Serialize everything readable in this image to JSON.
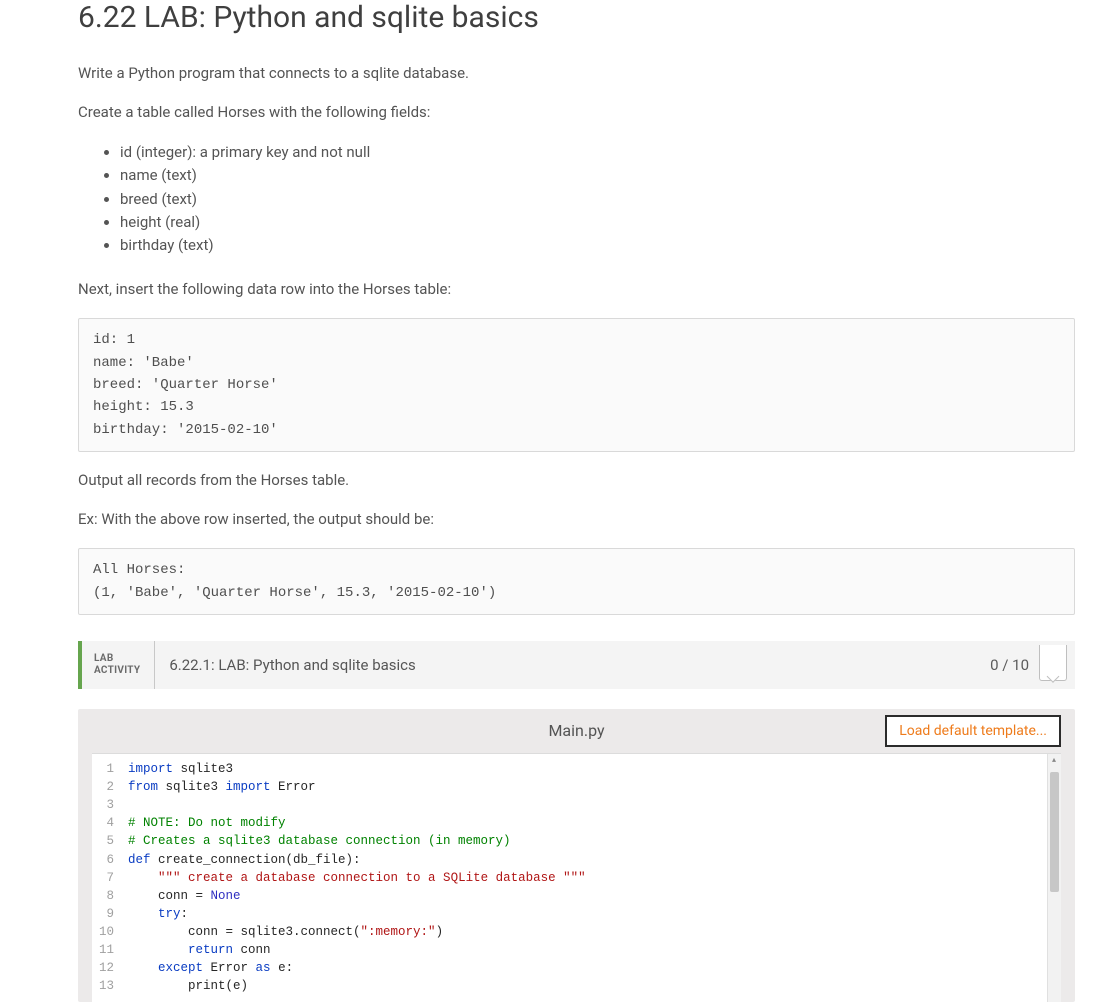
{
  "title": "6.22 LAB: Python and sqlite basics",
  "intro": {
    "p1": "Write a Python program that connects to a sqlite database.",
    "p2": "Create a table called Horses with the following fields:",
    "bullets": [
      "id (integer): a primary key and not null",
      "name (text)",
      "breed (text)",
      "height (real)",
      "birthday (text)"
    ],
    "p3": "Next, insert the following data row into the Horses table:"
  },
  "insert_block": "id: 1\nname: 'Babe'\nbreed: 'Quarter Horse'\nheight: 15.3\nbirthday: '2015-02-10'",
  "output_prompt": "Output all records from the Horses table.",
  "output_ex_label": "Ex: With the above row inserted, the output should be:",
  "output_block": "All Horses:\n(1, 'Babe', 'Quarter Horse', 15.3, '2015-02-10')",
  "lab": {
    "label_line1": "LAB",
    "label_line2": "ACTIVITY",
    "title": "6.22.1: LAB: Python and sqlite basics",
    "score": "0 / 10"
  },
  "editor": {
    "filename": "Main.py",
    "load_button": "Load default template...",
    "line_numbers": [
      "1",
      "2",
      "3",
      "4",
      "5",
      "6",
      "7",
      "8",
      "9",
      "10",
      "11",
      "12",
      "13"
    ],
    "tokens": [
      [
        [
          "kw",
          "import"
        ],
        [
          "id",
          " sqlite3"
        ]
      ],
      [
        [
          "kw",
          "from"
        ],
        [
          "id",
          " sqlite3 "
        ],
        [
          "kw",
          "import"
        ],
        [
          "id",
          " Error"
        ]
      ],
      [
        [
          "id",
          ""
        ]
      ],
      [
        [
          "cm",
          "# NOTE: Do not modify"
        ]
      ],
      [
        [
          "cm",
          "# Creates a sqlite3 database connection (in memory)"
        ]
      ],
      [
        [
          "kw",
          "def"
        ],
        [
          "id",
          " create_connection(db_file):"
        ]
      ],
      [
        [
          "id",
          "    "
        ],
        [
          "str",
          "\"\"\" create a database connection to a SQLite database \"\"\""
        ]
      ],
      [
        [
          "id",
          "    conn = "
        ],
        [
          "bltn",
          "None"
        ]
      ],
      [
        [
          "id",
          "    "
        ],
        [
          "kw",
          "try"
        ],
        [
          "id",
          ":"
        ]
      ],
      [
        [
          "id",
          "        conn = sqlite3.connect("
        ],
        [
          "str",
          "\":memory:\""
        ],
        [
          "id",
          ")"
        ]
      ],
      [
        [
          "id",
          "        "
        ],
        [
          "kw",
          "return"
        ],
        [
          "id",
          " conn"
        ]
      ],
      [
        [
          "id",
          "    "
        ],
        [
          "kw",
          "except"
        ],
        [
          "id",
          " Error "
        ],
        [
          "kw",
          "as"
        ],
        [
          "id",
          " e:"
        ]
      ],
      [
        [
          "id",
          "        print(e)"
        ]
      ]
    ]
  }
}
